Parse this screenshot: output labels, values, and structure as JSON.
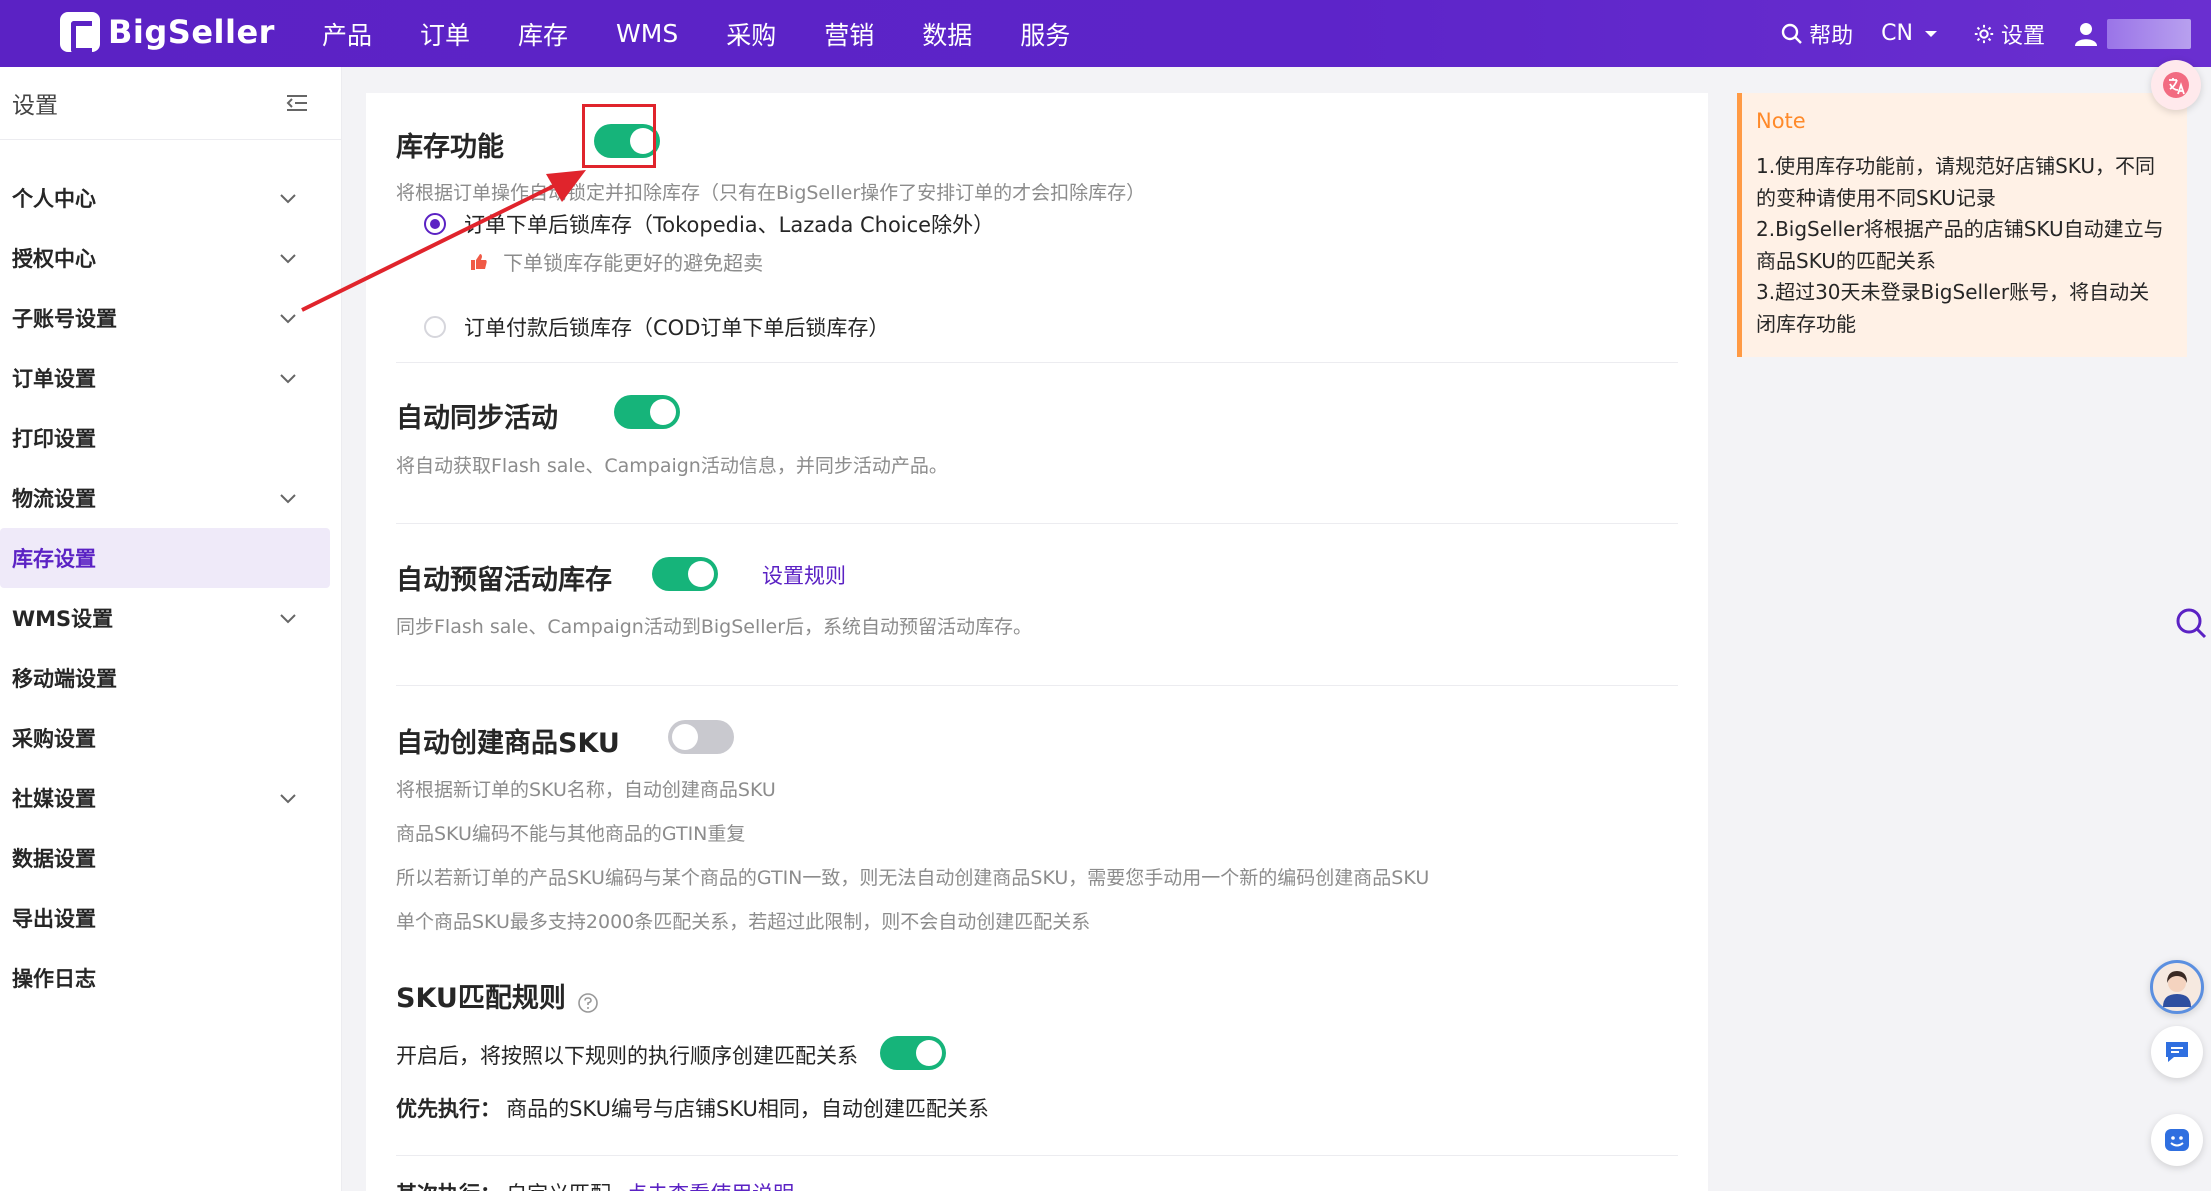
{
  "topbar": {
    "logo_text": "BigSeller",
    "nav": [
      "产品",
      "订单",
      "库存",
      "WMS",
      "采购",
      "营销",
      "数据",
      "服务"
    ],
    "help": "帮助",
    "lang": "CN",
    "settings": "设置"
  },
  "sidebar": {
    "title": "设置",
    "items": [
      {
        "label": "个人中心",
        "expandable": true
      },
      {
        "label": "授权中心",
        "expandable": true
      },
      {
        "label": "子账号设置",
        "expandable": true
      },
      {
        "label": "订单设置",
        "expandable": true
      },
      {
        "label": "打印设置",
        "expandable": false
      },
      {
        "label": "物流设置",
        "expandable": true
      },
      {
        "label": "库存设置",
        "expandable": false,
        "active": true
      },
      {
        "label": "WMS设置",
        "expandable": true
      },
      {
        "label": "移动端设置",
        "expandable": false
      },
      {
        "label": "采购设置",
        "expandable": false
      },
      {
        "label": "社媒设置",
        "expandable": true
      },
      {
        "label": "数据设置",
        "expandable": false
      },
      {
        "label": "导出设置",
        "expandable": false
      },
      {
        "label": "操作日志",
        "expandable": false
      }
    ]
  },
  "inventory": {
    "title": "库存功能",
    "enabled": true,
    "desc": "将根据订单操作自动锁定并扣除库存（只有在BigSeller操作了安排订单的才会扣除库存）",
    "option1": "订单下单后锁库存（Tokopedia、Lazada Choice除外）",
    "option1_hint": "下单锁库存能更好的避免超卖",
    "option2": "订单付款后锁库存（COD订单下单后锁库存）"
  },
  "sync": {
    "title": "自动同步活动",
    "enabled": true,
    "desc": "将自动获取Flash sale、Campaign活动信息，并同步活动产品。"
  },
  "reserve": {
    "title": "自动预留活动库存",
    "enabled": true,
    "link": "设置规则",
    "desc": "同步Flash sale、Campaign活动到BigSeller后，系统自动预留活动库存。"
  },
  "create_sku": {
    "title": "自动创建商品SKU",
    "enabled": false,
    "lines": [
      "将根据新订单的SKU名称，自动创建商品SKU",
      "商品SKU编码不能与其他商品的GTIN重复",
      "所以若新订单的产品SKU编码与某个商品的GTIN一致，则无法自动创建商品SKU，需要您手动用一个新的编码创建商品SKU",
      "单个商品SKU最多支持2000条匹配关系，若超过此限制，则不会自动创建匹配关系"
    ]
  },
  "sku_match": {
    "title": "SKU匹配规则",
    "enable_text": "开启后，将按照以下规则的执行顺序创建匹配关系",
    "enabled": true,
    "priority_label": "优先执行：",
    "priority_text": "商品的SKU编号与店铺SKU相同，自动创建匹配关系",
    "secondary_label": "其次执行：",
    "secondary_text": "自定义匹配",
    "secondary_link": "点击查看使用说明"
  },
  "note": {
    "title": "Note",
    "lines": [
      "1.使用库存功能前，请规范好店铺SKU，不同",
      "的变种请使用不同SKU记录",
      "2.BigSeller将根据产品的店铺SKU自动建立与",
      "商品SKU的匹配关系",
      "3.超过30天未登录BigSeller账号，将自动关",
      "闭库存功能"
    ]
  },
  "colors": {
    "brand": "#5b22c4",
    "toggle_on": "#16b47a",
    "note_accent": "#ff9a44",
    "annotation": "#e0242c"
  }
}
